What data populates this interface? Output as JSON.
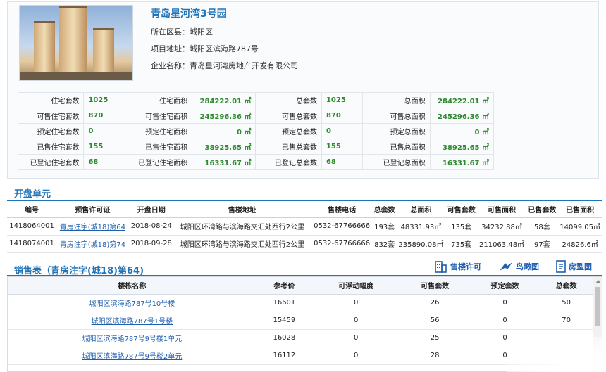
{
  "project": {
    "name": "青岛星河湾3号园",
    "district_label": "所在区县：",
    "district": "城阳区",
    "address_label": "项目地址：",
    "address": "城阳区滨海路787号",
    "company_label": "企业名称：",
    "company": "青岛星河湾房地产开发有限公司"
  },
  "stats": [
    [
      "住宅套数",
      "1025",
      "住宅面积",
      "284222.01 ㎡",
      "总套数",
      "1025",
      "总面积",
      "284222.01 ㎡"
    ],
    [
      "可售住宅套数",
      "870",
      "可售住宅面积",
      "245296.36 ㎡",
      "可售总套数",
      "870",
      "可售总面积",
      "245296.36 ㎡"
    ],
    [
      "预定住宅套数",
      "0",
      "预定住宅面积",
      "0 ㎡",
      "预定总套数",
      "0",
      "预定总面积",
      "0 ㎡"
    ],
    [
      "已售住宅套数",
      "155",
      "已售住宅面积",
      "38925.65 ㎡",
      "已售总套数",
      "155",
      "已售总面积",
      "38925.65 ㎡"
    ],
    [
      "已登记住宅套数",
      "68",
      "已登记住宅面积",
      "16331.67 ㎡",
      "已登记总套数",
      "68",
      "已登记总面积",
      "16331.67 ㎡"
    ]
  ],
  "open_units": {
    "title": "开盘单元",
    "headers": [
      "编号",
      "预售许可证",
      "开盘日期",
      "售楼地址",
      "售楼电话",
      "总套数",
      "总面积",
      "可售套数",
      "可售面积",
      "已售套数",
      "已售面积"
    ],
    "rows": [
      [
        "1418064001",
        "青房注字(城18)第64",
        "2018-08-24",
        "城阳区环湾路与滨海路交汇处西行2公里",
        "0532-67766666",
        "193套",
        "48331.93㎡",
        "135套",
        "34232.88㎡",
        "58套",
        "14099.05㎡"
      ],
      [
        "1418074001",
        "青房注字(城18)第74",
        "2018-09-28",
        "城阳区环湾路与滨海路交汇处西行2公里",
        "0532-67766666",
        "832套",
        "235890.08㎡",
        "735套",
        "211063.48㎡",
        "97套",
        "24826.6㎡"
      ]
    ]
  },
  "sales": {
    "title": "销售表（青房注字(城18)第64)",
    "tools": {
      "permit": "售楼许可",
      "aerial": "鸟瞰图",
      "floorplan": "房型图"
    },
    "headers": [
      "楼栋名称",
      "参考价",
      "可浮动幅度",
      "可售套数",
      "预定套数",
      "总套数"
    ],
    "rows": [
      [
        "城阳区滨海路787号10号楼",
        "16601",
        "0",
        "26",
        "0",
        "50"
      ],
      [
        "城阳区滨海路787号1号楼",
        "15459",
        "0",
        "56",
        "0",
        "70"
      ],
      [
        "城阳区滨海路787号9号楼1单元",
        "16028",
        "0",
        "25",
        "0",
        ""
      ],
      [
        "城阳区滨海路787号9号楼2单元",
        "16112",
        "0",
        "28",
        "0",
        ""
      ]
    ]
  },
  "colors": {
    "accent": "#1f73b7",
    "value_green": "#2c8a2c",
    "link": "#1f5fb0"
  }
}
